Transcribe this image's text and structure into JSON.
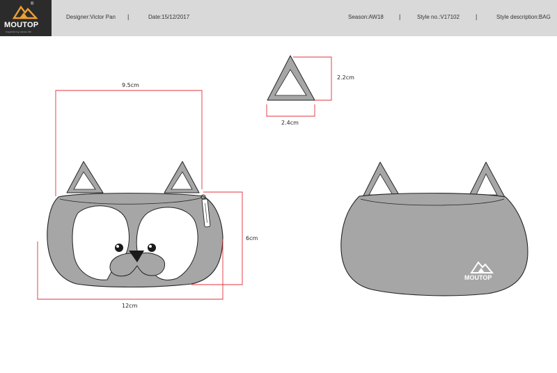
{
  "header": {
    "brand": "MOUTOP",
    "tagline": "Inspired by urban life",
    "designer": "Designer:Victor Pan",
    "date": "Date:15/12/2017",
    "season": "Season:AW18",
    "style_no": "Style no.:V17102",
    "style_description": "Style description:BAG",
    "separator": "|"
  },
  "dimensions": {
    "top_width": "9.5cm",
    "ear_height": "2.2cm",
    "ear_width": "2.4cm",
    "body_height": "6cm",
    "body_width": "12cm"
  },
  "back_logo": "MOUTOP",
  "colors": {
    "bag_fill": "#a6a6a6",
    "dimension_line": "#e0303a",
    "outline": "#222222",
    "header_bg": "#d9d9d9"
  }
}
